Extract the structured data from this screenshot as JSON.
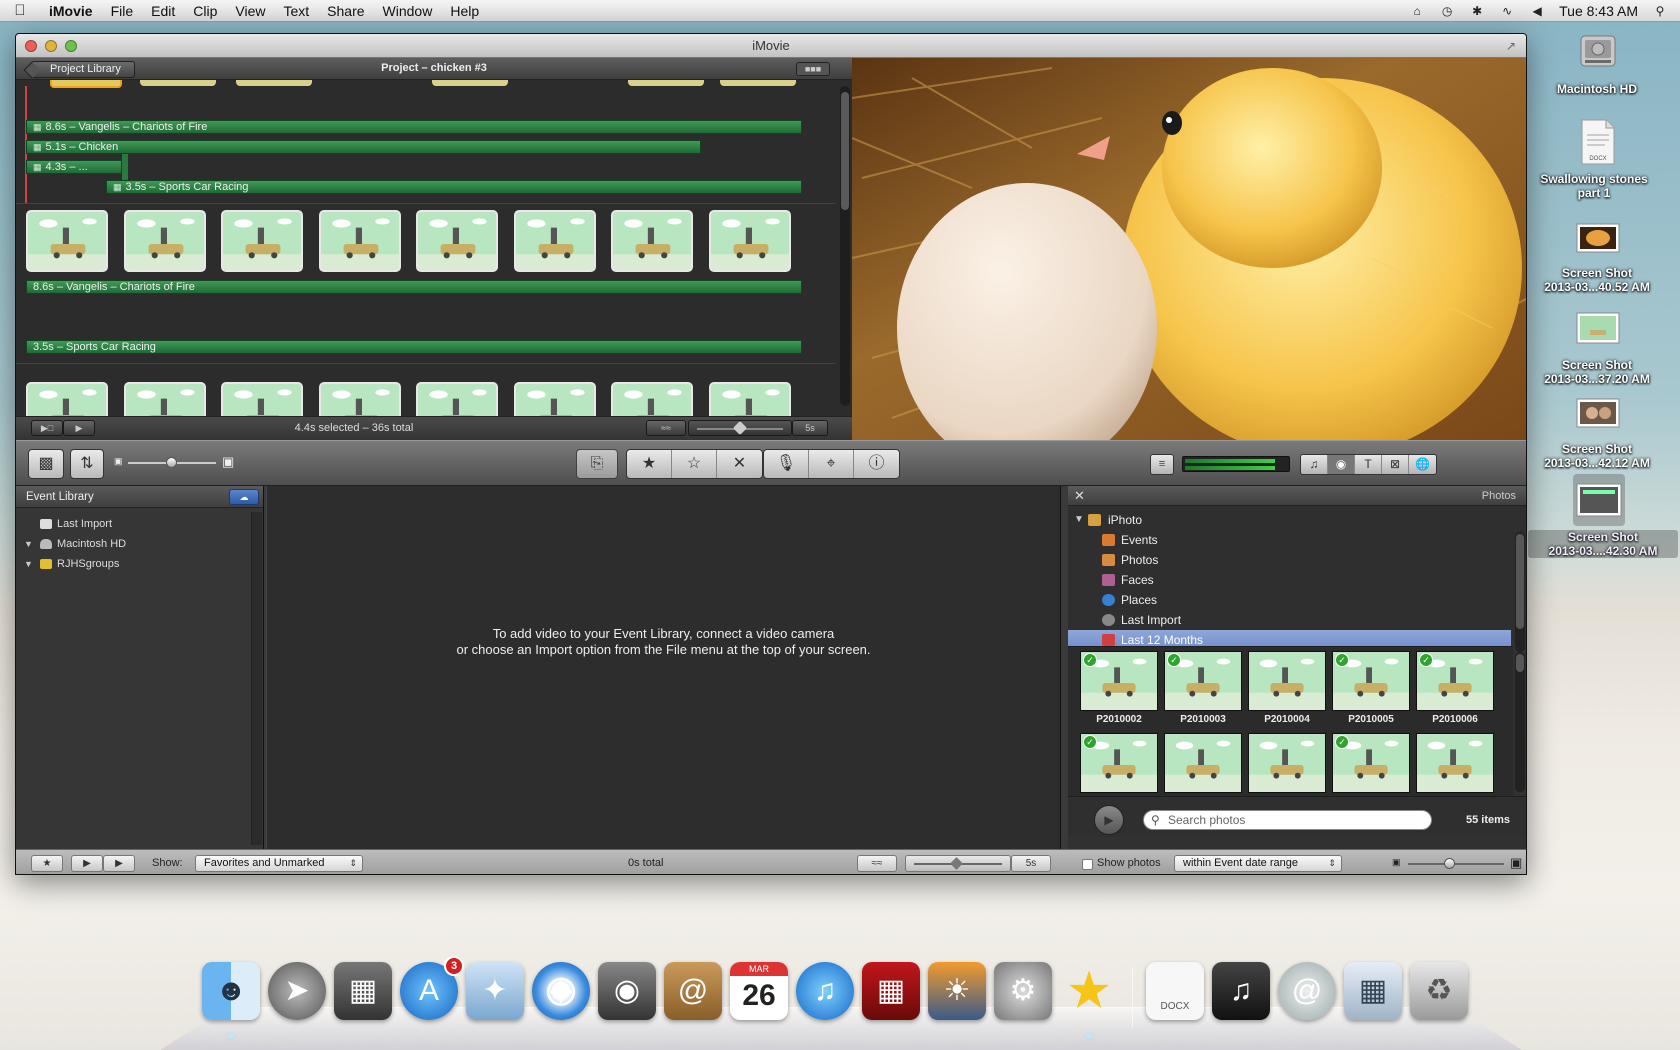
{
  "menubar": {
    "app": "iMovie",
    "items": [
      "File",
      "Edit",
      "Clip",
      "View",
      "Text",
      "Share",
      "Window",
      "Help"
    ],
    "clock": "Tue 8:43 AM"
  },
  "window": {
    "title": "iMovie",
    "project": {
      "back_label": "Project Library",
      "title": "Project – chicken #3",
      "status": "4.4s selected – 36s total",
      "zoom_label": "5s",
      "audio_clips": [
        {
          "label": "8.6s – Vangelis – Chariots of Fire"
        },
        {
          "label": "5.1s – Chicken"
        },
        {
          "label": "4.3s – ..."
        },
        {
          "label": "3.5s – Sports Car Racing"
        },
        {
          "label": "8.6s – Vangelis – Chariots of Fire"
        },
        {
          "label": "3.5s – Sports Car Racing"
        }
      ]
    },
    "event_library": {
      "title": "Event Library",
      "items": [
        {
          "label": "Last Import"
        },
        {
          "label": "Macintosh HD"
        },
        {
          "label": "RJHSgroups"
        }
      ],
      "empty_line1": "To add video to your Event Library, connect a video camera",
      "empty_line2": "or choose an Import option from the File menu at the top of your screen."
    },
    "photos": {
      "title": "Photos",
      "sources": [
        {
          "label": "iPhoto",
          "color": "#d8a040"
        },
        {
          "label": "Events",
          "color": "#d87a30"
        },
        {
          "label": "Photos",
          "color": "#d88a40"
        },
        {
          "label": "Faces",
          "color": "#b06090"
        },
        {
          "label": "Places",
          "color": "#3a80d0"
        },
        {
          "label": "Last Import",
          "color": "#888888"
        },
        {
          "label": "Last 12 Months",
          "color": "#d04040"
        }
      ],
      "selected_source": "Last 12 Months",
      "grid_row1": [
        {
          "name": "P2010002",
          "checked": true
        },
        {
          "name": "P2010003",
          "checked": true
        },
        {
          "name": "P2010004",
          "checked": false
        },
        {
          "name": "P2010005",
          "checked": true
        },
        {
          "name": "P2010006",
          "checked": true
        }
      ],
      "grid_row2_checked": [
        true,
        false,
        false,
        true,
        false
      ],
      "search_placeholder": "Search photos",
      "count": "55 items"
    },
    "bottom": {
      "show_label": "Show:",
      "show_value": "Favorites and Unmarked",
      "total": "0s total",
      "zoom_label": "5s",
      "show_photos_label": "Show photos",
      "range_value": "within Event date range"
    }
  },
  "desktop": {
    "icons": [
      {
        "label": "Macintosh HD"
      },
      {
        "label_line1": "Swallowing stones",
        "label_line2": "part 1"
      },
      {
        "label_line1": "Screen Shot",
        "label_line2": "2013-03...40.52 AM"
      },
      {
        "label_line1": "Screen Shot",
        "label_line2": "2013-03...37.20 AM"
      },
      {
        "label_line1": "Screen Shot",
        "label_line2": "2013-03...42.12 AM"
      },
      {
        "label_line1": "Screen Shot",
        "label_line2": "2013-03....42.30 AM"
      }
    ],
    "docx_label": "DOCX"
  },
  "dock": {
    "appstore_badge": "3",
    "calendar_month": "MAR",
    "calendar_day": "26",
    "docx_label": "DOCX"
  }
}
